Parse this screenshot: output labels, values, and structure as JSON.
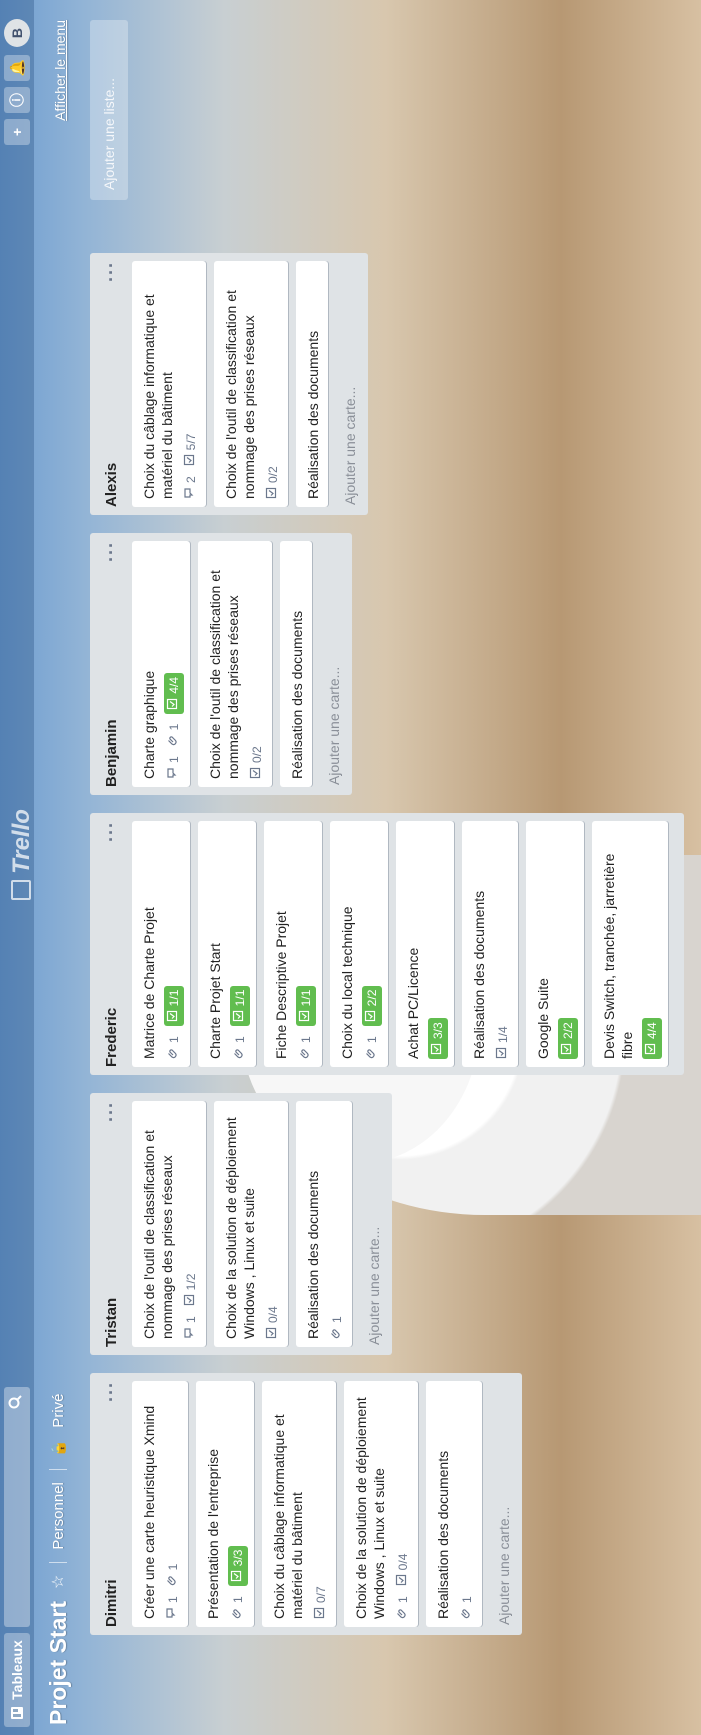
{
  "header": {
    "tableaux_label": "Tableaux",
    "logo_text": "Trello",
    "avatar_initial": "B"
  },
  "board": {
    "title": "Projet Start",
    "personal": "Personnel",
    "private": "Privé",
    "menu_link": "Afficher le menu",
    "add_list": "Ajouter une liste..."
  },
  "lists": [
    {
      "title": "Dimitri",
      "cards": [
        {
          "title": "Créer une carte heuristique Xmind",
          "comments": "1",
          "attachments": "1",
          "checklist": ""
        },
        {
          "title": "Présentation de l'entreprise",
          "comments": "",
          "attachments": "1",
          "checklist": "3/3"
        },
        {
          "title": "Choix du câblage informatique et matériel du bâtiment",
          "comments": "",
          "attachments": "",
          "checklist": "0/7"
        },
        {
          "title": "Choix de la solution de déploiement Windows , Linux et suite",
          "comments": "",
          "attachments": "1",
          "checklist": "0/4"
        },
        {
          "title": "Réalisation des documents",
          "comments": "",
          "attachments": "1",
          "checklist": ""
        }
      ],
      "add_card": "Ajouter une carte..."
    },
    {
      "title": "Tristan",
      "cards": [
        {
          "title": "Choix de l'outil de classification et nommage des prises réseaux",
          "comments": "1",
          "attachments": "",
          "checklist": "1/2"
        },
        {
          "title": "Choix de la solution de déploiement Windows , Linux et suite",
          "comments": "",
          "attachments": "",
          "checklist": "0/4"
        },
        {
          "title": "Réalisation des documents",
          "comments": "",
          "attachments": "1",
          "checklist": ""
        }
      ],
      "add_card": "Ajouter une carte..."
    },
    {
      "title": "Frederic",
      "cards": [
        {
          "title": "Matrice de Charte Projet",
          "comments": "",
          "attachments": "1",
          "checklist": "1/1"
        },
        {
          "title": "Charte Projet Start",
          "comments": "",
          "attachments": "1",
          "checklist": "1/1"
        },
        {
          "title": "Fiche Descriptive Projet",
          "comments": "",
          "attachments": "1",
          "checklist": "1/1"
        },
        {
          "title": "Choix du local technique",
          "comments": "",
          "attachments": "1",
          "checklist": "2/2"
        },
        {
          "title": "Achat PC/Licence",
          "comments": "",
          "attachments": "",
          "checklist": "3/3"
        },
        {
          "title": "Réalisation des documents",
          "comments": "",
          "attachments": "",
          "checklist": "1/4"
        },
        {
          "title": "Google Suite",
          "comments": "",
          "attachments": "",
          "checklist": "2/2"
        },
        {
          "title": "Devis Switch, tranchée, jarretière fibre",
          "comments": "",
          "attachments": "",
          "checklist": "4/4"
        }
      ],
      "add_card": ""
    },
    {
      "title": "Benjamin",
      "cards": [
        {
          "title": "Charte graphique",
          "comments": "1",
          "attachments": "1",
          "checklist": "4/4"
        },
        {
          "title": "Choix de l'outil de classification et nommage des prises réseaux",
          "comments": "",
          "attachments": "",
          "checklist": "0/2"
        },
        {
          "title": "Réalisation des documents",
          "comments": "",
          "attachments": "",
          "checklist": ""
        }
      ],
      "add_card": "Ajouter une carte..."
    },
    {
      "title": "Alexis",
      "cards": [
        {
          "title": "Choix du câblage informatique et matériel du bâtiment",
          "comments": "2",
          "attachments": "",
          "checklist": "5/7"
        },
        {
          "title": "Choix de l'outil de classification et nommage des prises réseaux",
          "comments": "",
          "attachments": "",
          "checklist": "0/2"
        },
        {
          "title": "Réalisation des documents",
          "comments": "",
          "attachments": "",
          "checklist": ""
        }
      ],
      "add_card": "Ajouter une carte..."
    }
  ]
}
